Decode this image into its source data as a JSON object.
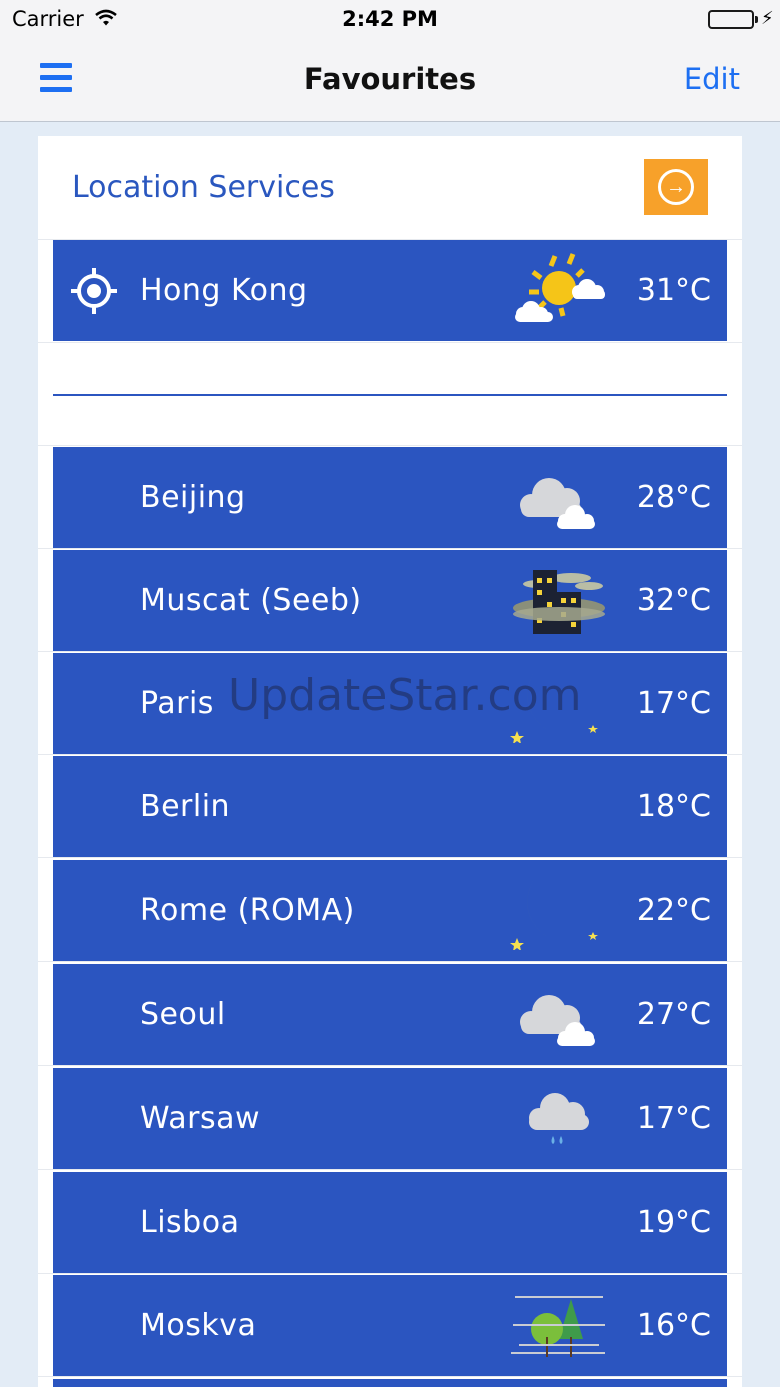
{
  "status_bar": {
    "carrier": "Carrier",
    "time": "2:42 PM",
    "bolt": "⚡"
  },
  "nav": {
    "title": "Favourites",
    "edit_label": "Edit",
    "menu_icon": "hamburger-menu-icon"
  },
  "location_services": {
    "title": "Location Services",
    "arrow_glyph": "→",
    "current": {
      "city": "Hong Kong",
      "temp": "31°C",
      "icon": "sunny-periods-icon"
    }
  },
  "favourites": [
    {
      "city": "Beijing",
      "temp": "28°C",
      "icon": "cloudy-icon"
    },
    {
      "city": "Muscat (Seeb)",
      "temp": "32°C",
      "icon": "night-haze-icon"
    },
    {
      "city": "Paris",
      "temp": "17°C",
      "icon": "moon-icon"
    },
    {
      "city": "Berlin",
      "temp": "18°C",
      "icon": ""
    },
    {
      "city": "Rome (ROMA)",
      "temp": "22°C",
      "icon": "moon-icon"
    },
    {
      "city": "Seoul",
      "temp": "27°C",
      "icon": "cloudy-icon"
    },
    {
      "city": "Warsaw",
      "temp": "17°C",
      "icon": "light-rain-icon"
    },
    {
      "city": "Lisboa",
      "temp": "19°C",
      "icon": ""
    },
    {
      "city": "Moskva",
      "temp": "16°C",
      "icon": "mist-trees-icon"
    }
  ],
  "watermark": "UpdateStar.com",
  "colors": {
    "row_blue": "#2b55c0",
    "accent_blue": "#1d6ff2",
    "arrow_orange": "#f7a12a",
    "background": "#e3ecf6"
  }
}
